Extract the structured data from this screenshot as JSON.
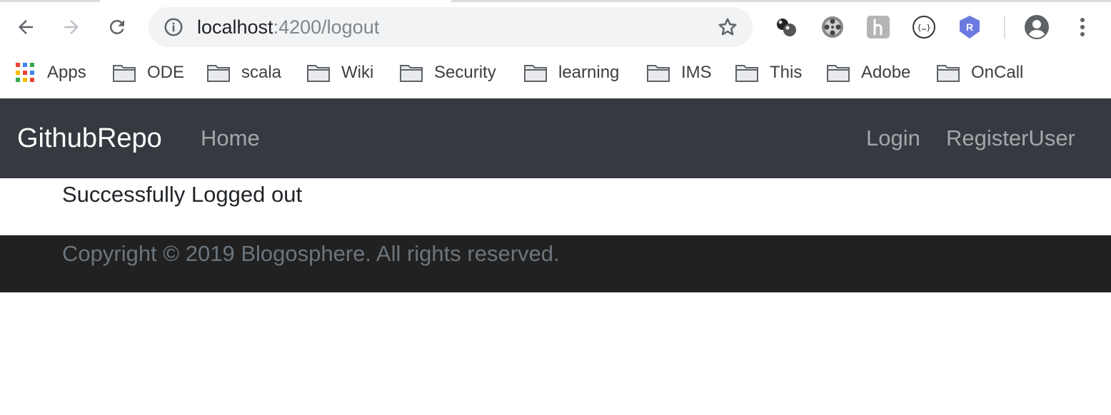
{
  "browser": {
    "url_host": "localhost",
    "url_path": ":4200/logout",
    "extensions": [
      "molecule-icon",
      "film-reel-icon",
      "hippo-icon",
      "json-braces-icon",
      "r-shield-icon"
    ],
    "bookmarks": [
      "Apps",
      "ODE",
      "scala",
      "Wiki",
      "Security",
      "learning",
      "IMS",
      "This",
      "Adobe",
      "OnCall"
    ]
  },
  "navbar": {
    "brand": "GithubRepo",
    "home": "Home",
    "login": "Login",
    "register": "RegisterUser",
    "bg_color": "#343a40"
  },
  "main": {
    "message": "Successfully Logged out"
  },
  "footer": {
    "copyright": "Copyright © 2019 Blogosphere. All rights reserved.",
    "bg_color": "#212121"
  }
}
